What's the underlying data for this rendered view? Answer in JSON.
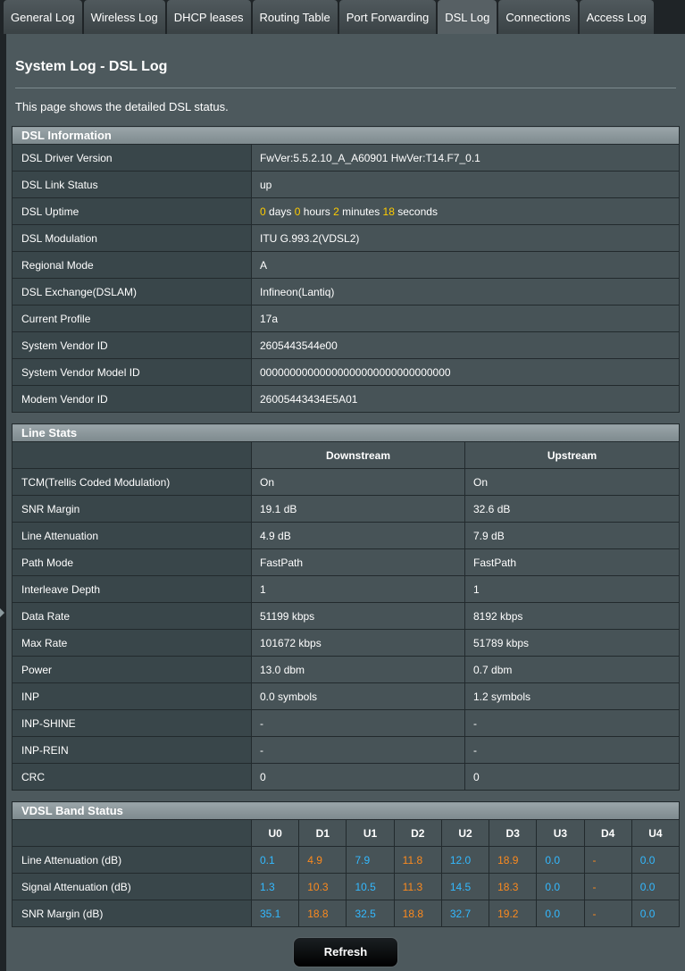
{
  "tabs": [
    "General Log",
    "Wireless Log",
    "DHCP leases",
    "Routing Table",
    "Port Forwarding",
    "DSL Log",
    "Connections",
    "Access Log"
  ],
  "active_tab": "DSL Log",
  "page_title": "System Log - DSL Log",
  "description": "This page shows the detailed DSL status.",
  "dsl_info": {
    "title": "DSL Information",
    "driver_version": {
      "label": "DSL Driver Version",
      "value": "FwVer:5.5.2.10_A_A60901 HwVer:T14.F7_0.1"
    },
    "link_status": {
      "label": "DSL Link Status",
      "value": "up"
    },
    "uptime": {
      "label": "DSL Uptime",
      "days": "0",
      "days_unit": "days",
      "hours": "0",
      "hours_unit": "hours",
      "minutes": "2",
      "minutes_unit": "minutes",
      "seconds": "18",
      "seconds_unit": "seconds"
    },
    "modulation": {
      "label": "DSL Modulation",
      "value": "ITU G.993.2(VDSL2)"
    },
    "regional_mode": {
      "label": "Regional Mode",
      "value": "A"
    },
    "exchange": {
      "label": "DSL Exchange(DSLAM)",
      "value": "Infineon(Lantiq)"
    },
    "profile": {
      "label": "Current Profile",
      "value": "17a"
    },
    "vendor_id": {
      "label": "System Vendor ID",
      "value": "2605443544e00"
    },
    "vendor_model_id": {
      "label": "System Vendor Model ID",
      "value": "00000000000000000000000000000000"
    },
    "modem_vendor_id": {
      "label": "Modem Vendor ID",
      "value": "26005443434E5A01"
    }
  },
  "line_stats": {
    "title": "Line Stats",
    "downstream_label": "Downstream",
    "upstream_label": "Upstream",
    "rows": [
      {
        "label": "TCM(Trellis Coded Modulation)",
        "down": "On",
        "up": "On"
      },
      {
        "label": "SNR Margin",
        "down": "19.1 dB",
        "up": "32.6 dB"
      },
      {
        "label": "Line Attenuation",
        "down": "4.9 dB",
        "up": "7.9 dB"
      },
      {
        "label": "Path Mode",
        "down": "FastPath",
        "up": "FastPath"
      },
      {
        "label": "Interleave Depth",
        "down": "1",
        "up": "1"
      },
      {
        "label": "Data Rate",
        "down": "51199 kbps",
        "up": "8192 kbps"
      },
      {
        "label": "Max Rate",
        "down": "101672 kbps",
        "up": "51789 kbps"
      },
      {
        "label": "Power",
        "down": "13.0 dbm",
        "up": "0.7 dbm"
      },
      {
        "label": "INP",
        "down": "0.0 symbols",
        "up": "1.2 symbols"
      },
      {
        "label": "INP-SHINE",
        "down": "-",
        "up": "-"
      },
      {
        "label": "INP-REIN",
        "down": "-",
        "up": "-"
      },
      {
        "label": "CRC",
        "down": "0",
        "up": "0"
      }
    ]
  },
  "band_status": {
    "title": "VDSL Band Status",
    "bands": [
      "U0",
      "D1",
      "U1",
      "D2",
      "U2",
      "D3",
      "U3",
      "D4",
      "U4"
    ],
    "rows": [
      {
        "label": "Line Attenuation (dB)",
        "values": [
          "0.1",
          "4.9",
          "7.9",
          "11.8",
          "12.0",
          "18.9",
          "0.0",
          "-",
          "0.0"
        ]
      },
      {
        "label": "Signal Attenuation (dB)",
        "values": [
          "1.3",
          "10.3",
          "10.5",
          "11.3",
          "14.5",
          "18.3",
          "0.0",
          "-",
          "0.0"
        ]
      },
      {
        "label": "SNR Margin (dB)",
        "values": [
          "35.1",
          "18.8",
          "32.5",
          "18.8",
          "32.7",
          "19.2",
          "0.0",
          "-",
          "0.0"
        ]
      }
    ],
    "colors": {
      "upstream": "#33b9ff",
      "downstream": "#fc8a1e"
    }
  },
  "refresh_label": "Refresh",
  "colors": {
    "highlight": "#ffcc00",
    "panel": "#4d595d",
    "background": "#1f2427"
  }
}
